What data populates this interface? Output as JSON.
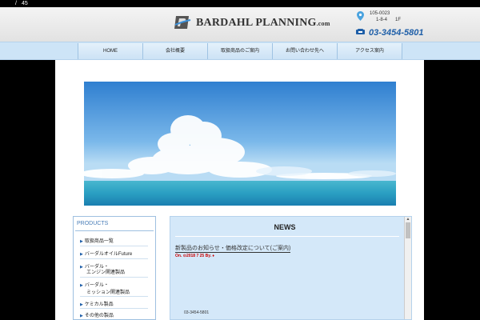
{
  "topbar": {
    "slash": "/",
    "count": "45"
  },
  "header": {
    "brand_main": "BARDAHL PLANNING",
    "brand_suffix": ".com",
    "postal": "105-0023",
    "address_a": "1-8-4",
    "address_b": "1F",
    "phone": "03-3454-5801"
  },
  "nav": {
    "items": [
      "HOME",
      "会社概要",
      "取扱商品のご案内",
      "お問い合わせ先へ",
      "アクセス案内"
    ]
  },
  "sidebar": {
    "title": "PRODUCTS",
    "items": [
      "取扱商品一覧",
      "バーダルオイルFuture",
      "バーダル・",
      "エンジン関連製品",
      "バーダル・",
      "ミッション関連製品",
      "ケミカル製品",
      "その他の製品"
    ]
  },
  "news": {
    "title": "NEWS",
    "article_title": "新製品のお知らせ・価格改定について(ご案内)",
    "meta_on": "On.",
    "meta_date": "2018 7 25",
    "meta_by": "By.",
    "body_phone": "03-3454-5801"
  },
  "colors": {
    "nav_bg": "#cde4f7",
    "accent": "#1f5fa8",
    "news_bg": "#d4e8f9"
  }
}
